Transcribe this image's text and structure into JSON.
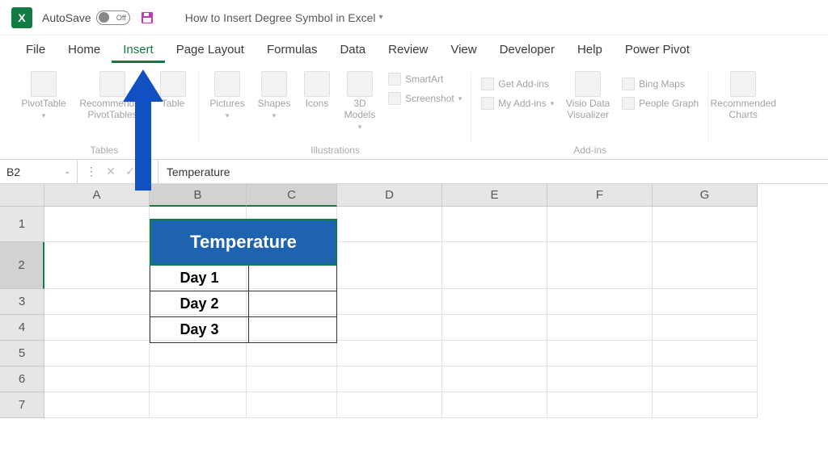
{
  "titlebar": {
    "autosave_label": "AutoSave",
    "autosave_state": "Off",
    "doc_title": "How to Insert Degree Symbol in Excel"
  },
  "tabs": [
    "File",
    "Home",
    "Insert",
    "Page Layout",
    "Formulas",
    "Data",
    "Review",
    "View",
    "Developer",
    "Help",
    "Power Pivot"
  ],
  "active_tab": "Insert",
  "ribbon": {
    "tables": {
      "label": "Tables",
      "pivottable": "PivotTable",
      "recommended": "Recommended PivotTables",
      "table": "Table"
    },
    "illustrations": {
      "label": "Illustrations",
      "pictures": "Pictures",
      "shapes": "Shapes",
      "icons": "Icons",
      "models": "3D Models",
      "smartart": "SmartArt",
      "screenshot": "Screenshot"
    },
    "addins": {
      "label": "Add-ins",
      "get": "Get Add-ins",
      "my": "My Add-ins",
      "visio": "Visio Data Visualizer",
      "bing": "Bing Maps",
      "people": "People Graph"
    },
    "charts_hint": "Recommended Charts"
  },
  "formula_bar": {
    "name_box": "B2",
    "content": "Temperature"
  },
  "columns": [
    "A",
    "B",
    "C",
    "D",
    "E",
    "F",
    "G"
  ],
  "rows": [
    "1",
    "2",
    "3",
    "4",
    "5",
    "6",
    "7"
  ],
  "selected_cell_row": "2",
  "table": {
    "header": "Temperature",
    "rows": [
      "Day 1",
      "Day 2",
      "Day 3"
    ]
  }
}
